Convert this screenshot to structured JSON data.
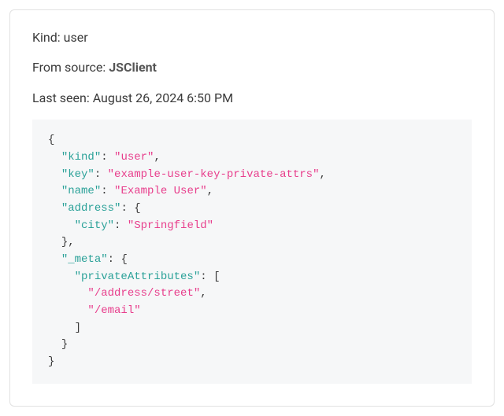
{
  "meta": {
    "kind_label": "Kind:",
    "kind_value": "user",
    "source_label": "From source:",
    "source_value": "JSClient",
    "last_seen_label": "Last seen:",
    "last_seen_value": "August 26, 2024 6:50 PM"
  },
  "json_payload": {
    "kind": "user",
    "key": "example-user-key-private-attrs",
    "name": "Example User",
    "address": {
      "city": "Springfield"
    },
    "_meta": {
      "privateAttributes": [
        "/address/street",
        "/email"
      ]
    }
  }
}
